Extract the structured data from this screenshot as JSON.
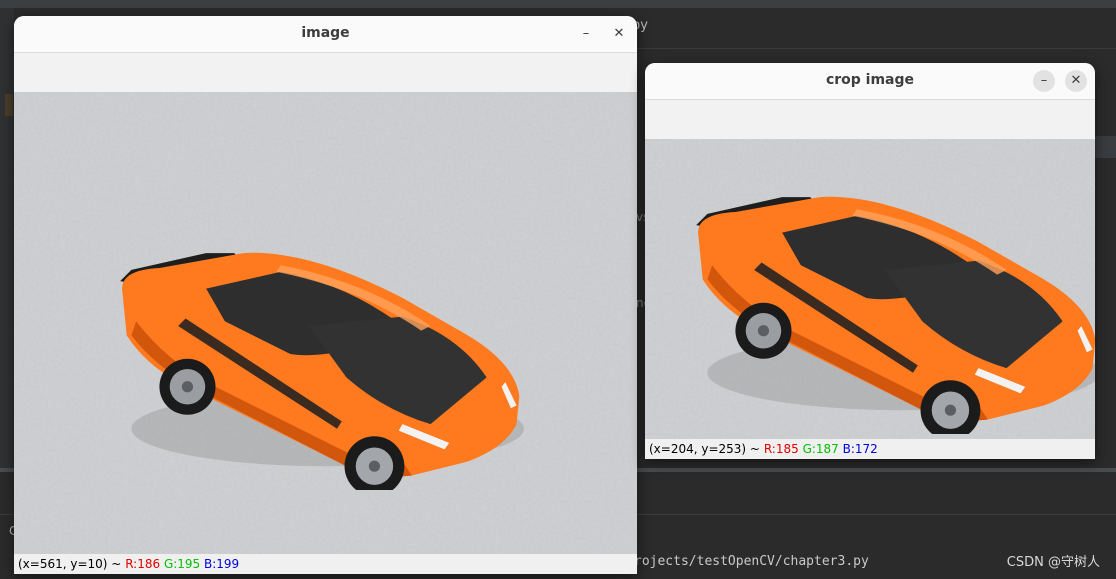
{
  "ide": {
    "tab_text": "py",
    "terminal_path": "rojects/testOpenCV/chapter3.py",
    "watermark": "CSDN @守树人",
    "ghost_chars": [
      "c",
      "vs",
      "ng",
      "C"
    ]
  },
  "image_window": {
    "title": "image",
    "minimize_glyph": "–",
    "close_glyph": "✕",
    "status": {
      "coords": "(x=561, y=10) ~",
      "r": "R:186",
      "g": "G:195",
      "b": "B:199"
    }
  },
  "crop_window": {
    "title": "crop image",
    "minimize_glyph": "–",
    "close_glyph": "✕",
    "status": {
      "coords": "(x=204, y=253) ~",
      "r": "R:185",
      "g": "G:187",
      "b": "B:172"
    }
  },
  "colors": {
    "car_body": "#ff7a1f",
    "car_shadow": "#c9520a",
    "carpet": "#c4c6c8",
    "window_glass": "#2e2e2e"
  }
}
